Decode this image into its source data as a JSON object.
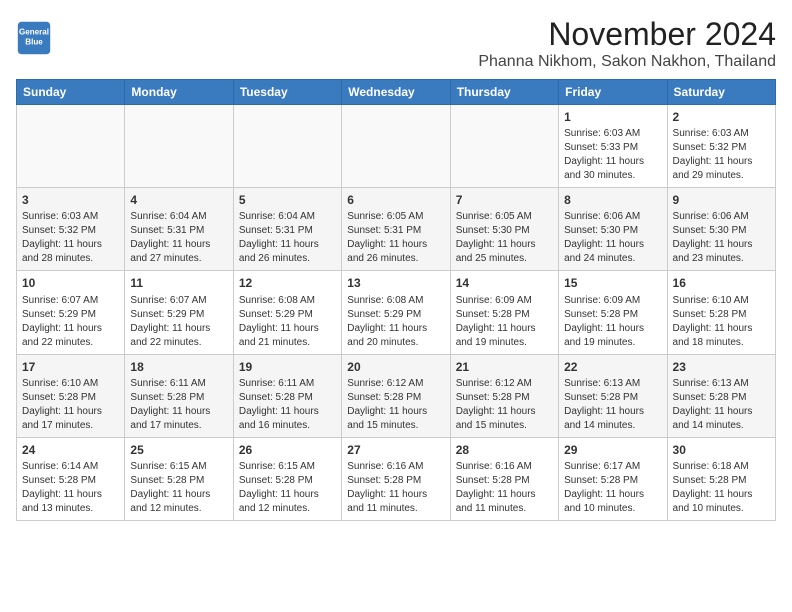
{
  "logo": {
    "line1": "General",
    "line2": "Blue"
  },
  "title": "November 2024",
  "subtitle": "Phanna Nikhom, Sakon Nakhon, Thailand",
  "weekdays": [
    "Sunday",
    "Monday",
    "Tuesday",
    "Wednesday",
    "Thursday",
    "Friday",
    "Saturday"
  ],
  "weeks": [
    [
      {
        "day": "",
        "detail": ""
      },
      {
        "day": "",
        "detail": ""
      },
      {
        "day": "",
        "detail": ""
      },
      {
        "day": "",
        "detail": ""
      },
      {
        "day": "",
        "detail": ""
      },
      {
        "day": "1",
        "detail": "Sunrise: 6:03 AM\nSunset: 5:33 PM\nDaylight: 11 hours\nand 30 minutes."
      },
      {
        "day": "2",
        "detail": "Sunrise: 6:03 AM\nSunset: 5:32 PM\nDaylight: 11 hours\nand 29 minutes."
      }
    ],
    [
      {
        "day": "3",
        "detail": "Sunrise: 6:03 AM\nSunset: 5:32 PM\nDaylight: 11 hours\nand 28 minutes."
      },
      {
        "day": "4",
        "detail": "Sunrise: 6:04 AM\nSunset: 5:31 PM\nDaylight: 11 hours\nand 27 minutes."
      },
      {
        "day": "5",
        "detail": "Sunrise: 6:04 AM\nSunset: 5:31 PM\nDaylight: 11 hours\nand 26 minutes."
      },
      {
        "day": "6",
        "detail": "Sunrise: 6:05 AM\nSunset: 5:31 PM\nDaylight: 11 hours\nand 26 minutes."
      },
      {
        "day": "7",
        "detail": "Sunrise: 6:05 AM\nSunset: 5:30 PM\nDaylight: 11 hours\nand 25 minutes."
      },
      {
        "day": "8",
        "detail": "Sunrise: 6:06 AM\nSunset: 5:30 PM\nDaylight: 11 hours\nand 24 minutes."
      },
      {
        "day": "9",
        "detail": "Sunrise: 6:06 AM\nSunset: 5:30 PM\nDaylight: 11 hours\nand 23 minutes."
      }
    ],
    [
      {
        "day": "10",
        "detail": "Sunrise: 6:07 AM\nSunset: 5:29 PM\nDaylight: 11 hours\nand 22 minutes."
      },
      {
        "day": "11",
        "detail": "Sunrise: 6:07 AM\nSunset: 5:29 PM\nDaylight: 11 hours\nand 22 minutes."
      },
      {
        "day": "12",
        "detail": "Sunrise: 6:08 AM\nSunset: 5:29 PM\nDaylight: 11 hours\nand 21 minutes."
      },
      {
        "day": "13",
        "detail": "Sunrise: 6:08 AM\nSunset: 5:29 PM\nDaylight: 11 hours\nand 20 minutes."
      },
      {
        "day": "14",
        "detail": "Sunrise: 6:09 AM\nSunset: 5:28 PM\nDaylight: 11 hours\nand 19 minutes."
      },
      {
        "day": "15",
        "detail": "Sunrise: 6:09 AM\nSunset: 5:28 PM\nDaylight: 11 hours\nand 19 minutes."
      },
      {
        "day": "16",
        "detail": "Sunrise: 6:10 AM\nSunset: 5:28 PM\nDaylight: 11 hours\nand 18 minutes."
      }
    ],
    [
      {
        "day": "17",
        "detail": "Sunrise: 6:10 AM\nSunset: 5:28 PM\nDaylight: 11 hours\nand 17 minutes."
      },
      {
        "day": "18",
        "detail": "Sunrise: 6:11 AM\nSunset: 5:28 PM\nDaylight: 11 hours\nand 17 minutes."
      },
      {
        "day": "19",
        "detail": "Sunrise: 6:11 AM\nSunset: 5:28 PM\nDaylight: 11 hours\nand 16 minutes."
      },
      {
        "day": "20",
        "detail": "Sunrise: 6:12 AM\nSunset: 5:28 PM\nDaylight: 11 hours\nand 15 minutes."
      },
      {
        "day": "21",
        "detail": "Sunrise: 6:12 AM\nSunset: 5:28 PM\nDaylight: 11 hours\nand 15 minutes."
      },
      {
        "day": "22",
        "detail": "Sunrise: 6:13 AM\nSunset: 5:28 PM\nDaylight: 11 hours\nand 14 minutes."
      },
      {
        "day": "23",
        "detail": "Sunrise: 6:13 AM\nSunset: 5:28 PM\nDaylight: 11 hours\nand 14 minutes."
      }
    ],
    [
      {
        "day": "24",
        "detail": "Sunrise: 6:14 AM\nSunset: 5:28 PM\nDaylight: 11 hours\nand 13 minutes."
      },
      {
        "day": "25",
        "detail": "Sunrise: 6:15 AM\nSunset: 5:28 PM\nDaylight: 11 hours\nand 12 minutes."
      },
      {
        "day": "26",
        "detail": "Sunrise: 6:15 AM\nSunset: 5:28 PM\nDaylight: 11 hours\nand 12 minutes."
      },
      {
        "day": "27",
        "detail": "Sunrise: 6:16 AM\nSunset: 5:28 PM\nDaylight: 11 hours\nand 11 minutes."
      },
      {
        "day": "28",
        "detail": "Sunrise: 6:16 AM\nSunset: 5:28 PM\nDaylight: 11 hours\nand 11 minutes."
      },
      {
        "day": "29",
        "detail": "Sunrise: 6:17 AM\nSunset: 5:28 PM\nDaylight: 11 hours\nand 10 minutes."
      },
      {
        "day": "30",
        "detail": "Sunrise: 6:18 AM\nSunset: 5:28 PM\nDaylight: 11 hours\nand 10 minutes."
      }
    ]
  ]
}
